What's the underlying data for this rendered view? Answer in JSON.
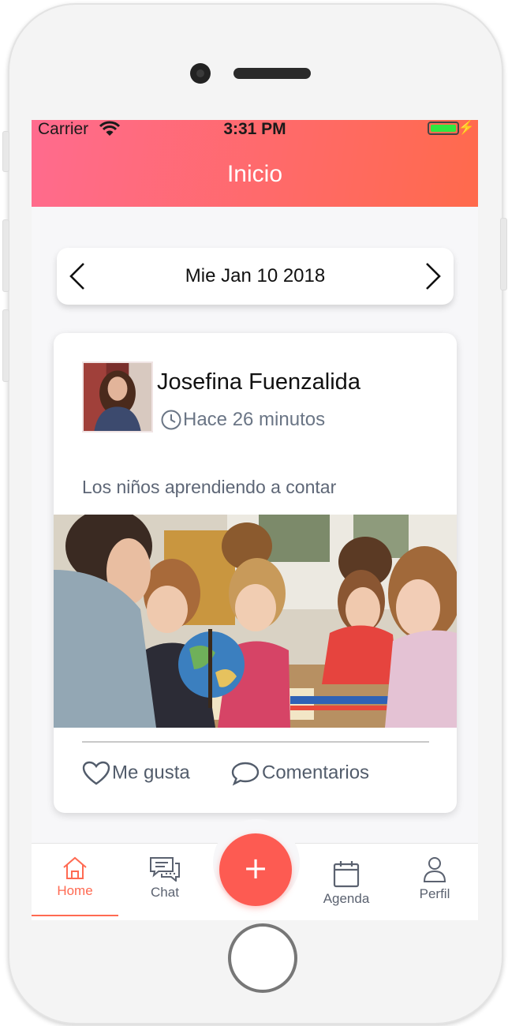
{
  "status_bar": {
    "carrier": "Carrier",
    "time": "3:31 PM"
  },
  "header": {
    "title": "Inicio"
  },
  "date_picker": {
    "date": "Mie Jan 10 2018"
  },
  "post": {
    "author": "Josefina Fuenzalida",
    "time_ago": "Hace 26 minutos",
    "caption": "Los niños aprendiendo a contar",
    "like_label": "Me gusta",
    "comments_label": "Comentarios"
  },
  "tab_bar": {
    "active": "Home",
    "items": [
      {
        "label": "Home",
        "icon": "home-icon"
      },
      {
        "label": "Chat",
        "icon": "chat-icon"
      },
      {
        "label": "Agenda",
        "icon": "calendar-icon"
      },
      {
        "label": "Perfil",
        "icon": "person-icon"
      }
    ],
    "fab_symbol": "+"
  },
  "colors": {
    "accent": "#ff6a52",
    "header_start": "#ff6b8e",
    "header_end": "#ff6a4c",
    "fab": "#fd5b52"
  }
}
